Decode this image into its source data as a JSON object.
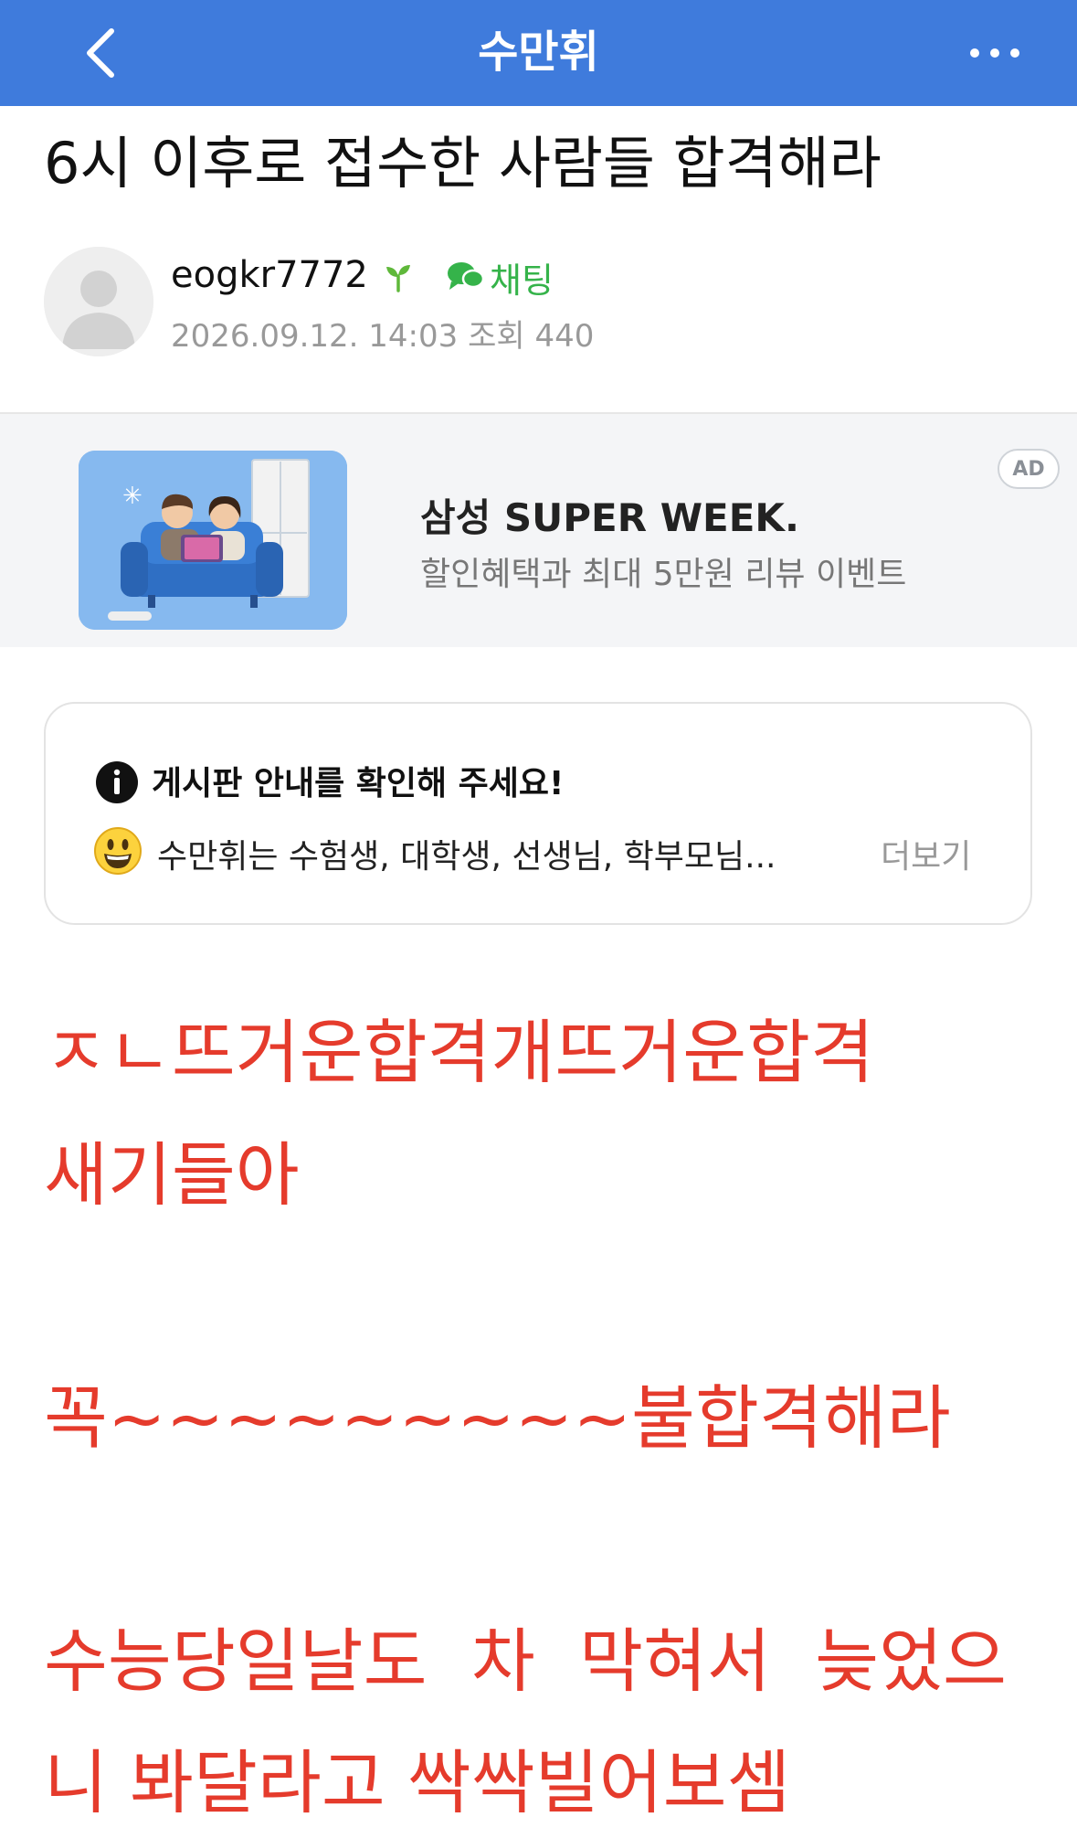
{
  "header": {
    "title": "수만휘",
    "back_icon": "chevron-left-icon",
    "more_icon": "more-horizontal-icon",
    "background_color": "#3f7bdc"
  },
  "post": {
    "title": "6시 이후로 접수한 사람들 합격해라",
    "author": "eogkr7772",
    "author_badge_icon": "sprout-icon",
    "chat_label": "채팅",
    "date": "2026.09.12. 14:03",
    "views_label": "조회",
    "views": "440"
  },
  "ad": {
    "title": "삼성 SUPER WEEK.",
    "subtitle": "할인혜택과 최대 5만원 리뷰 이벤트",
    "badge": "AD"
  },
  "notice": {
    "title": "게시판 안내를 확인해 주세요!",
    "body": "수만휘는 수험생, 대학생, 선생님, 학부모님...",
    "more_label": "더보기"
  },
  "content": {
    "lines": [
      "ㅈㄴ뜨거운합격개뜨거운합격",
      "새기들아",
      "꼭~~~~~~~~~불합격해라",
      "수능당일날도  차  막혀서  늦었으",
      "니 봐달라고 싹싹빌어보셈"
    ],
    "text_color": "#e53b2c"
  }
}
